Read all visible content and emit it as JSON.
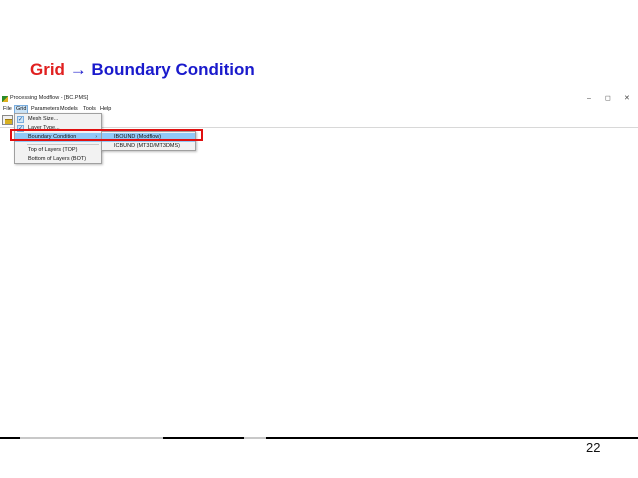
{
  "slide": {
    "title_part1": "Grid",
    "title_arrow": "→",
    "title_part2": "Boundary Condition",
    "page_number": "22"
  },
  "window": {
    "title": "Processing Modflow - [BC.PMS]",
    "minimize": "–",
    "maximize": "◻",
    "close": "✕"
  },
  "menubar": {
    "items": [
      "File",
      "Grid",
      "Parameters",
      "Models",
      "Tools",
      "Help"
    ]
  },
  "grid_menu": {
    "items": [
      "Mesh Size...",
      "Layer Type...",
      "Boundary Condition",
      "Top of Layers (TOP)",
      "Bottom of Layers (BOT)"
    ],
    "check": "✓",
    "submenu_arrow": "›"
  },
  "boundary_submenu": {
    "items": [
      "IBOUND (Modflow)",
      "ICBUND (MT3D/MT3DMS)"
    ]
  },
  "colors": {
    "title_red": "#e02020",
    "title_blue": "#1a1acc",
    "highlight": "#91c9f7",
    "annotation_red": "#e01010"
  },
  "icons": {
    "app": "processing-modflow-icon",
    "toolbar": "open-folder-icon"
  }
}
